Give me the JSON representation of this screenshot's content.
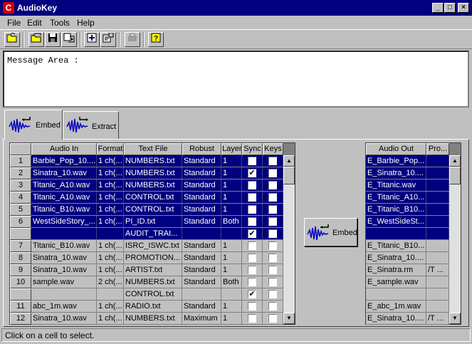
{
  "window": {
    "title": "AudioKey",
    "icon": "C"
  },
  "menu": [
    "File",
    "Edit",
    "Tools",
    "Help"
  ],
  "toolbar_icons": [
    "open-folder-icon",
    "open-file-icon",
    "save-icon",
    "save-as-icon",
    "add-icon",
    "properties-icon",
    "print-icon",
    "help-icon"
  ],
  "message_area": {
    "text": "Message Area :"
  },
  "tabs": {
    "embed": "Embed",
    "extract": "Extract"
  },
  "embed_button": "Embed",
  "input_table": {
    "columns": [
      "Audio In",
      "Format",
      "Text File",
      "Robust",
      "Layer",
      "Sync",
      "Keys"
    ],
    "rows": [
      {
        "num": "1",
        "audio": "Barbie_Pop_10....",
        "format": "1 ch(...",
        "text": "NUMBERS.txt",
        "robust": "Standard",
        "layer": "1",
        "sync": false,
        "keys": false,
        "selected": true
      },
      {
        "num": "2",
        "audio": "Sinatra_10.wav",
        "format": "1 ch(...",
        "text": "NUMBERS.txt",
        "robust": "Standard",
        "layer": "1",
        "sync": true,
        "keys": false,
        "selected": true
      },
      {
        "num": "3",
        "audio": "Titanic_A10.wav",
        "format": "1 ch(...",
        "text": "NUMBERS.txt",
        "robust": "Standard",
        "layer": "1",
        "sync": false,
        "keys": false,
        "selected": true
      },
      {
        "num": "4",
        "audio": "Titanic_A10.wav",
        "format": "1 ch(...",
        "text": "CONTROL.txt",
        "robust": "Standard",
        "layer": "1",
        "sync": false,
        "keys": false,
        "selected": true
      },
      {
        "num": "5",
        "audio": "Titanic_B10.wav",
        "format": "1 ch(...",
        "text": "CONTROL.txt",
        "robust": "Standard",
        "layer": "1",
        "sync": false,
        "keys": false,
        "selected": true
      },
      {
        "num": "6",
        "audio": "WestSideStory_...",
        "format": "1 ch(...",
        "text": "PI_ID.txt",
        "robust": "Standard",
        "layer": "Both",
        "sync": false,
        "keys": false,
        "selected": true
      },
      {
        "num": "",
        "audio": "",
        "format": "",
        "text": "AUDIT_TRAI...",
        "robust": "",
        "layer": "",
        "sync": true,
        "keys": false,
        "selected": true
      },
      {
        "num": "7",
        "audio": "Titanic_B10.wav",
        "format": "1 ch(...",
        "text": "ISRC_ISWC.txt",
        "robust": "Standard",
        "layer": "1",
        "sync": false,
        "keys": false,
        "selected": false
      },
      {
        "num": "8",
        "audio": "Sinatra_10.wav",
        "format": "1 ch(...",
        "text": "PROMOTION...",
        "robust": "Standard",
        "layer": "1",
        "sync": false,
        "keys": false,
        "selected": false
      },
      {
        "num": "9",
        "audio": "Sinatra_10.wav",
        "format": "1 ch(...",
        "text": "ARTIST.txt",
        "robust": "Standard",
        "layer": "1",
        "sync": false,
        "keys": false,
        "selected": false
      },
      {
        "num": "10",
        "audio": "sample.wav",
        "format": "2 ch(...",
        "text": "NUMBERS.txt",
        "robust": "Standard",
        "layer": "Both",
        "sync": false,
        "keys": false,
        "selected": false
      },
      {
        "num": "",
        "audio": "",
        "format": "",
        "text": "CONTROL.txt",
        "robust": "",
        "layer": "",
        "sync": true,
        "keys": false,
        "selected": false
      },
      {
        "num": "11",
        "audio": "abc_1m.wav",
        "format": "1 ch(...",
        "text": "RADIO.txt",
        "robust": "Standard",
        "layer": "1",
        "sync": false,
        "keys": false,
        "selected": false
      },
      {
        "num": "12",
        "audio": "Sinatra_10.wav",
        "format": "1 ch(...",
        "text": "NUMBERS.txt",
        "robust": "Maximum",
        "layer": "1",
        "sync": false,
        "keys": false,
        "selected": false
      }
    ]
  },
  "output_table": {
    "columns": [
      "Audio Out",
      "Pro..."
    ],
    "rows": [
      {
        "out": "E_Barbie_Pop...",
        "pro": "",
        "selected": true
      },
      {
        "out": "E_Sinatra_10....",
        "pro": "",
        "selected": true
      },
      {
        "out": "E_Titanic.wav",
        "pro": "",
        "selected": true
      },
      {
        "out": "E_Titanic_A10...",
        "pro": "",
        "selected": true
      },
      {
        "out": "E_Titanic_B10...",
        "pro": "",
        "selected": true
      },
      {
        "out": "E_WestSideSt...",
        "pro": "",
        "selected": true
      },
      {
        "out": "",
        "pro": "",
        "selected": true
      },
      {
        "out": "E_Titanic_B10...",
        "pro": "",
        "selected": false
      },
      {
        "out": "E_Sinatra_10....",
        "pro": "",
        "selected": false
      },
      {
        "out": "E_Sinatra.rm",
        "pro": "/T ...",
        "selected": false
      },
      {
        "out": "E_sample.wav",
        "pro": "",
        "selected": false
      },
      {
        "out": "",
        "pro": "",
        "selected": false
      },
      {
        "out": "E_abc_1m.wav",
        "pro": "",
        "selected": false
      },
      {
        "out": "E_Sinatra_10.rm",
        "pro": "/T ...",
        "selected": false
      }
    ]
  },
  "status_bar": {
    "text": "Click on a cell to select."
  }
}
